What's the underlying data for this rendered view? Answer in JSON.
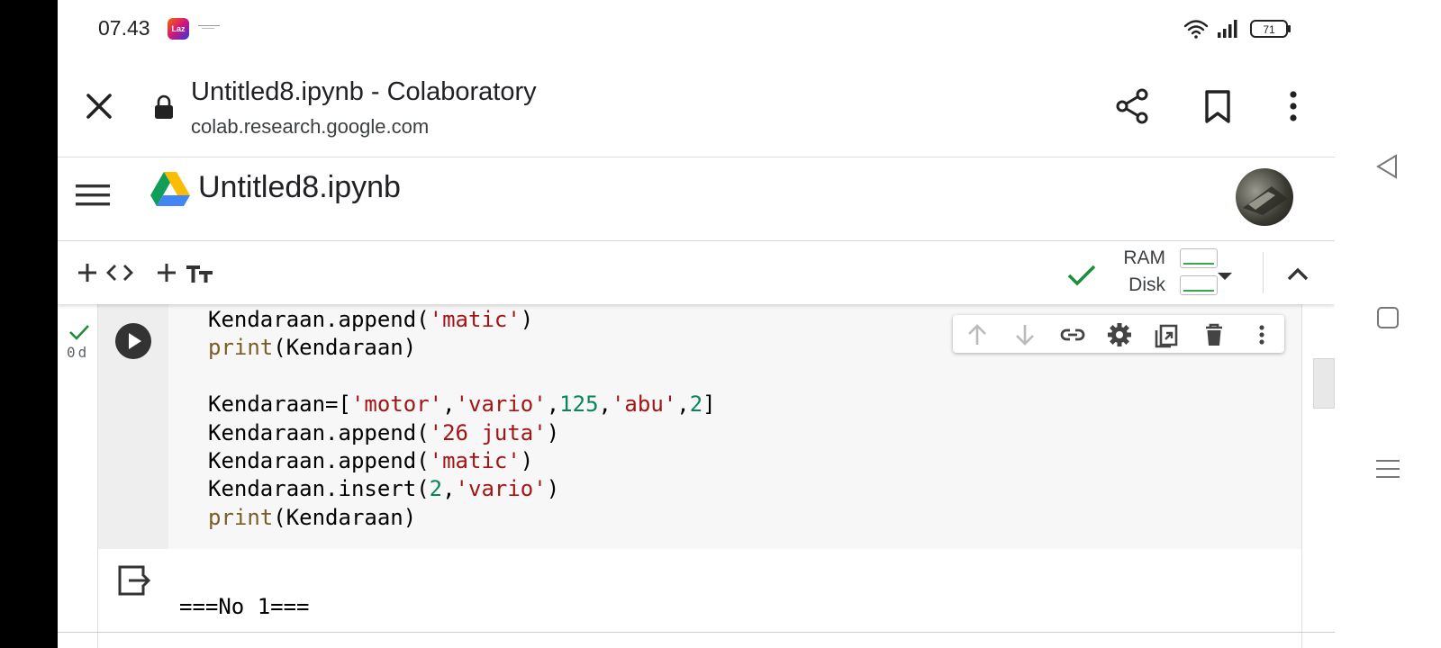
{
  "status_bar": {
    "time": "07.43",
    "lazada_badge": "Laz",
    "battery": "71"
  },
  "browser": {
    "title": "Untitled8.ipynb - Colaboratory",
    "url": "colab.research.google.com"
  },
  "colab": {
    "notebook_title": "Untitled8.ipynb"
  },
  "toolbar": {
    "ram_label": "RAM",
    "disk_label": "Disk",
    "status_color": "#1e8e3e"
  },
  "cell": {
    "exec_label": "0d",
    "code_lines": [
      [
        [
          "p",
          "Kendaraan.append("
        ],
        [
          "s",
          "'matic'"
        ],
        [
          "p",
          ")"
        ]
      ],
      [
        [
          "f",
          "print"
        ],
        [
          "p",
          "(Kendaraan)"
        ]
      ],
      [
        [
          "p",
          ""
        ]
      ],
      [
        [
          "p",
          "Kendaraan=["
        ],
        [
          "s",
          "'motor'"
        ],
        [
          "p",
          ","
        ],
        [
          "s",
          "'vario'"
        ],
        [
          "p",
          ","
        ],
        [
          "n",
          "125"
        ],
        [
          "p",
          ","
        ],
        [
          "s",
          "'abu'"
        ],
        [
          "p",
          ","
        ],
        [
          "n",
          "2"
        ],
        [
          "p",
          "]"
        ]
      ],
      [
        [
          "p",
          "Kendaraan.append("
        ],
        [
          "s",
          "'26 juta'"
        ],
        [
          "p",
          ")"
        ]
      ],
      [
        [
          "p",
          "Kendaraan.append("
        ],
        [
          "s",
          "'matic'"
        ],
        [
          "p",
          ")"
        ]
      ],
      [
        [
          "p",
          "Kendaraan.insert("
        ],
        [
          "n",
          "2"
        ],
        [
          "p",
          ","
        ],
        [
          "s",
          "'vario'"
        ],
        [
          "p",
          ")"
        ]
      ],
      [
        [
          "f",
          "print"
        ],
        [
          "p",
          "(Kendaraan)"
        ]
      ]
    ],
    "syntax_colors": {
      "string": "#a31515",
      "number": "#098658",
      "builtin": "#795e26"
    }
  },
  "output": {
    "first_line": "===No 1==="
  },
  "icons": [
    "close-icon",
    "lock-icon",
    "share-icon",
    "bookmark-icon",
    "more-vert-icon",
    "hamburger-icon",
    "drive-icon",
    "add-code-icon",
    "add-text-icon",
    "check-icon",
    "chevron-down-icon",
    "chevron-up-icon",
    "run-icon",
    "arrow-up-icon",
    "arrow-down-icon",
    "link-icon",
    "gear-icon",
    "mirror-cell-icon",
    "delete-icon",
    "output-icon",
    "back-icon",
    "home-icon",
    "recents-icon"
  ]
}
